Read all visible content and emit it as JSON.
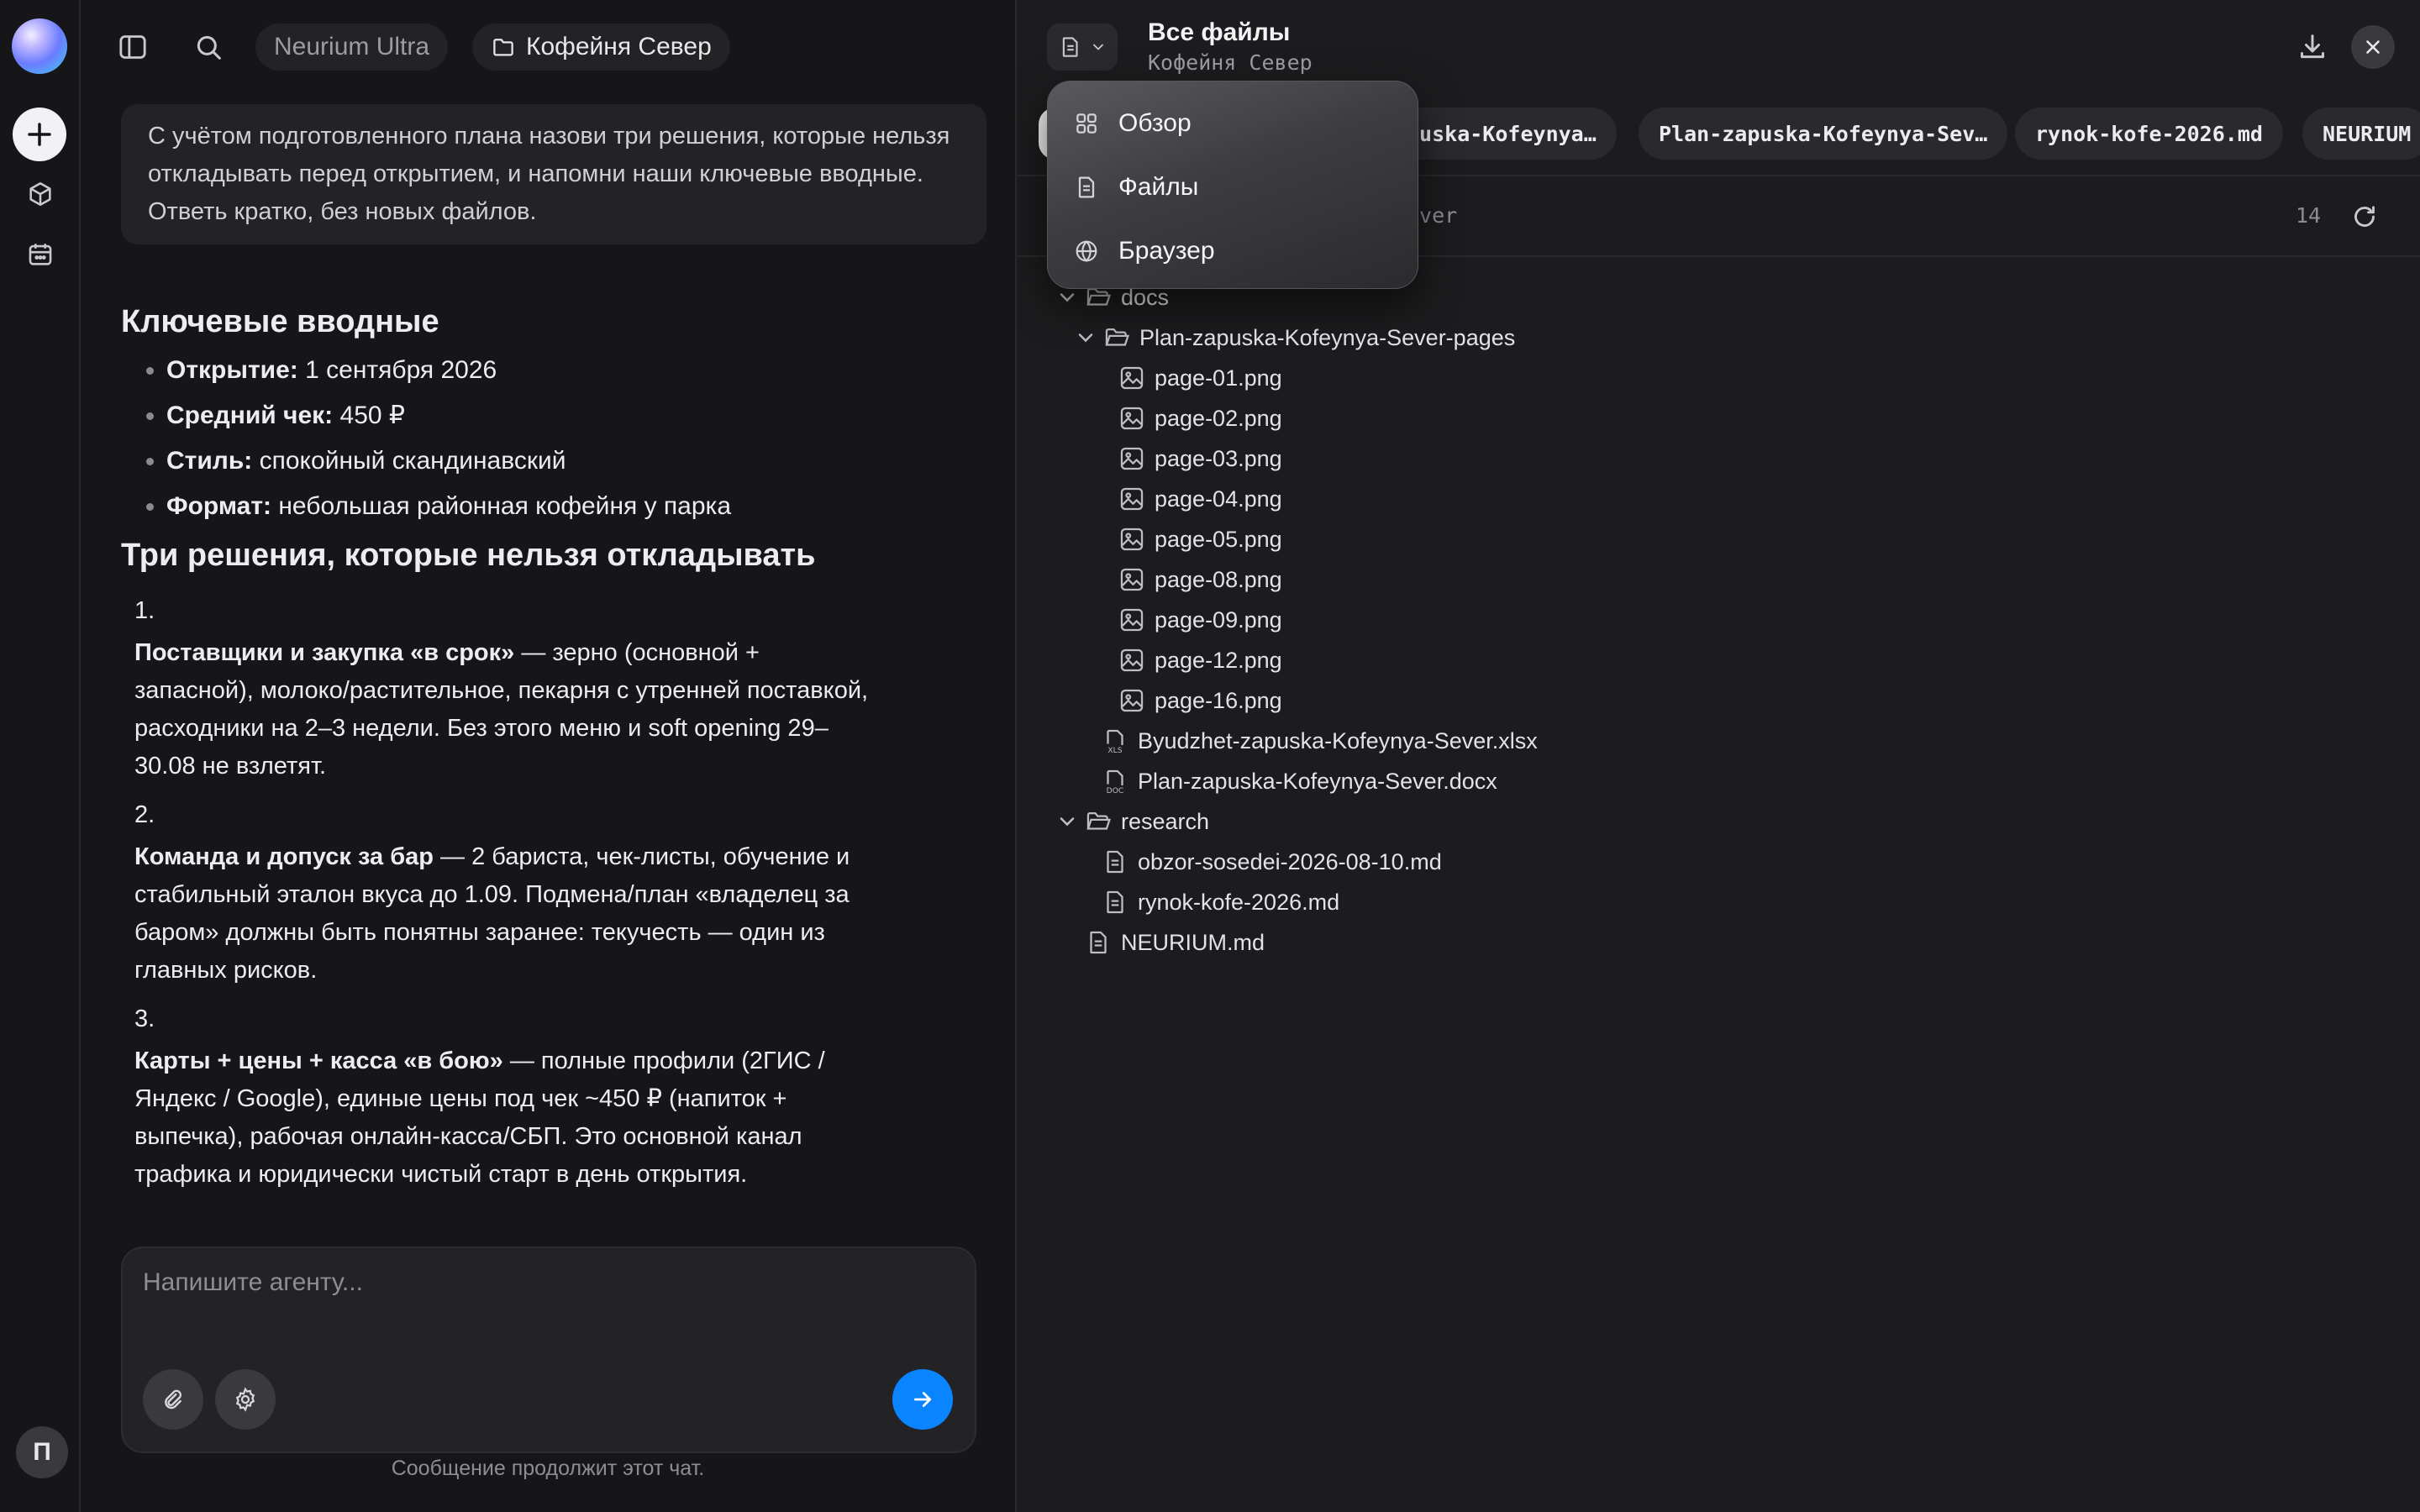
{
  "chat": {
    "model_pill": "Neurium Ultra",
    "project_pill": "Кофейня Север",
    "user_message": "С учётом подготовленного плана назови три решения, которые нельзя откладывать перед открытием, и напомни наши ключевые вводные. Ответь кратко, без новых файлов.",
    "answer": {
      "heading_inputs": "Ключевые вводные",
      "inputs": [
        {
          "label": "Открытие:",
          "value": " 1 сентября 2026"
        },
        {
          "label": "Средний чек:",
          "value": " 450 ₽"
        },
        {
          "label": "Стиль:",
          "value": " спокойный скандинавский"
        },
        {
          "label": "Формат:",
          "value": " небольшая районная кофейня у парка"
        }
      ],
      "heading_decisions": "Три решения, которые нельзя откладывать",
      "decisions": [
        {
          "num": "1.",
          "title": "Поставщики и закупка «в срок»",
          "text": " — зерно (основной + запасной), молоко/растительное, пекарня с утренней поставкой, расходники на 2–3 недели. Без этого меню и soft opening 29–30.08 не взлетят."
        },
        {
          "num": "2.",
          "title": "Команда и допуск за бар",
          "text": " — 2 бариста, чек-листы, обучение и стабильный эталон вкуса до 1.09. Подмена/план «владелец за баром» должны быть понятны заранее: текучесть — один из главных рисков."
        },
        {
          "num": "3.",
          "title": "Карты + цены + касса «в бою»",
          "text": " — полные профили (2ГИС / Яндекс / Google), единые цены под чек ~450 ₽ (напиток + выпечка), рабочая онлайн-касса/СБП. Это основной канал трафика и юридически чистый старт в день открытия."
        }
      ]
    },
    "composer": {
      "placeholder": "Напишите агенту...",
      "hint": "Сообщение продолжит этот чат."
    },
    "user_initial": "П"
  },
  "files": {
    "title": "Все файлы",
    "subtitle": "Кофейня Север",
    "tabs": [
      "puska-Kofeynya…",
      "Plan-zapuska-Kofeynya-Sev…",
      "rynok-kofe-2026.md",
      "NEURIUM"
    ],
    "path_text": "ever",
    "count": "14",
    "tree": [
      {
        "name": "docs",
        "type": "folder",
        "depth": 0,
        "open": true
      },
      {
        "name": "Plan-zapuska-Kofeynya-Sever-pages",
        "type": "folder",
        "depth": 1,
        "open": true
      },
      {
        "name": "page-01.png",
        "type": "image",
        "depth": 2
      },
      {
        "name": "page-02.png",
        "type": "image",
        "depth": 2
      },
      {
        "name": "page-03.png",
        "type": "image",
        "depth": 2
      },
      {
        "name": "page-04.png",
        "type": "image",
        "depth": 2
      },
      {
        "name": "page-05.png",
        "type": "image",
        "depth": 2
      },
      {
        "name": "page-08.png",
        "type": "image",
        "depth": 2
      },
      {
        "name": "page-09.png",
        "type": "image",
        "depth": 2
      },
      {
        "name": "page-12.png",
        "type": "image",
        "depth": 2
      },
      {
        "name": "page-16.png",
        "type": "image",
        "depth": 2
      },
      {
        "name": "Byudzhet-zapuska-Kofeynya-Sever.xlsx",
        "type": "xls",
        "depth": 1
      },
      {
        "name": "Plan-zapuska-Kofeynya-Sever.docx",
        "type": "doc",
        "depth": 1
      },
      {
        "name": "research",
        "type": "folder",
        "depth": 0,
        "open": true
      },
      {
        "name": "obzor-sosedei-2026-08-10.md",
        "type": "md",
        "depth": 1
      },
      {
        "name": "rynok-kofe-2026.md",
        "type": "md",
        "depth": 1
      },
      {
        "name": "NEURIUM.md",
        "type": "md",
        "depth": 0
      }
    ],
    "menu": [
      {
        "label": "Обзор",
        "icon": "grid-icon"
      },
      {
        "label": "Файлы",
        "icon": "file-icon"
      },
      {
        "label": "Браузер",
        "icon": "globe-icon"
      }
    ]
  },
  "colors": {
    "accent": "#0a84ff",
    "panel": "#1c1c1e",
    "sidebar": "#161618"
  }
}
